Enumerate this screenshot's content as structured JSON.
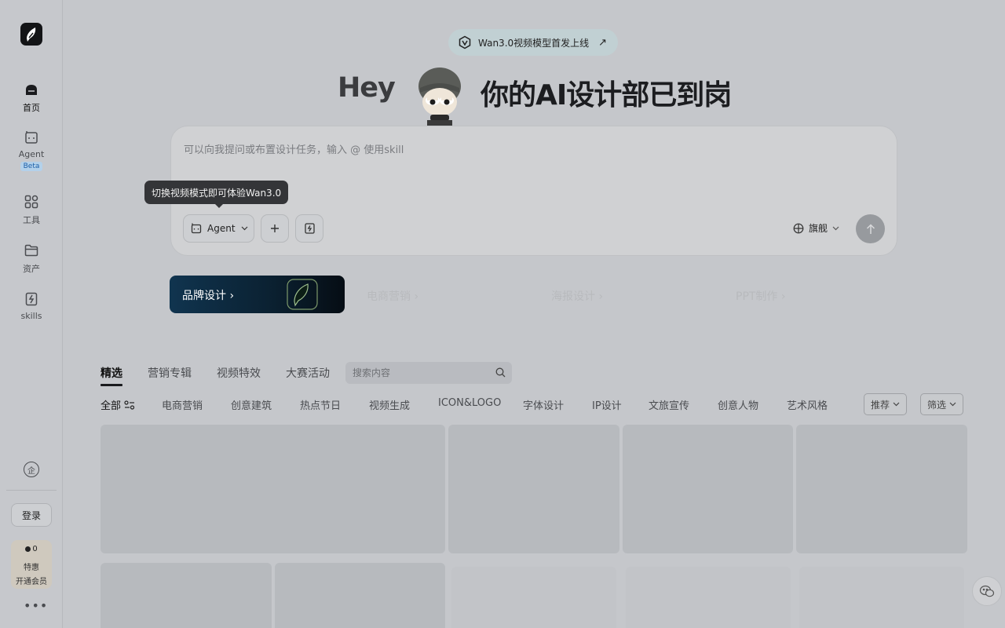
{
  "sidebar": {
    "items": [
      {
        "label": "首页",
        "icon": "home-icon"
      },
      {
        "label": "Agent",
        "icon": "agent-icon",
        "badge": "Beta"
      },
      {
        "label": "工具",
        "icon": "tools-grid-icon"
      },
      {
        "label": "资产",
        "icon": "folder-icon"
      },
      {
        "label": "skills",
        "icon": "skills-icon"
      }
    ],
    "enterprise_icon_glyph": "企",
    "login_label": "登录",
    "member": {
      "points": "0",
      "promo": "特惠",
      "join": "开通会员"
    },
    "more_glyph": "•••"
  },
  "announcement": {
    "text": "Wan3.0视频模型首发上线",
    "arrow": "↗"
  },
  "hero": {
    "hey": "Hey",
    "title": "你的AI设计部已到岗"
  },
  "composer": {
    "placeholder": "可以向我提问或布置设计任务，输入 @ 使用skill",
    "tooltip": "切换视频模式即可体验Wan3.0",
    "agent_label": "Agent",
    "model_label": "旗舰"
  },
  "categories": [
    {
      "label": "品牌设计",
      "arrow": "›"
    },
    {
      "label": "电商营销",
      "arrow": "›"
    },
    {
      "label": "海报设计",
      "arrow": "›"
    },
    {
      "label": "PPT制作",
      "arrow": "›"
    }
  ],
  "tabs": [
    "精选",
    "营销专辑",
    "视频特效",
    "大赛活动"
  ],
  "search": {
    "placeholder": "搜索内容"
  },
  "filters": [
    "全部",
    "电商营销",
    "创意建筑",
    "热点节日",
    "视频生成",
    "ICON&LOGO",
    "字体设计",
    "IP设计",
    "文旅宣传",
    "创意人物",
    "艺术风格"
  ],
  "sort_label": "推荐",
  "filter_label": "筛选",
  "colors": {
    "accent_dark": "#0b2233",
    "beta_bg": "#b3d1ea",
    "beta_text": "#1d5fa8"
  }
}
